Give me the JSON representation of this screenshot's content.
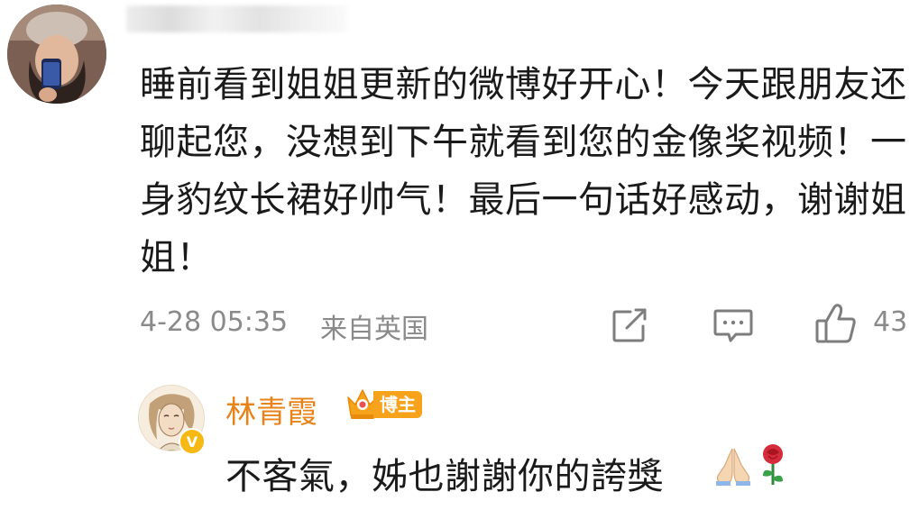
{
  "comment": {
    "text": "睡前看到姐姐更新的微博好开心！今天跟朋友还聊起您，没想到下午就看到您的金像奖视频！一身豹纹长裙好帅气！最后一句话好感动，谢谢姐姐！",
    "timestamp": "4-28 05:35",
    "source": "来自英国",
    "like_count": "43",
    "icons": [
      "avatar",
      "share-icon",
      "comment-icon",
      "like-icon"
    ]
  },
  "reply": {
    "author": "林青霞",
    "badge": "博主",
    "text": "不客氣，姊也謝謝你的誇獎",
    "icons": [
      "crown-icon",
      "verified-badge",
      "prayer-icon",
      "rose-icon"
    ]
  },
  "colors": {
    "meta_gray": "#8a8a8a",
    "author_orange": "#e8831a",
    "badge_orange": "#f7a21b",
    "verified_yellow": "#f6b813"
  }
}
